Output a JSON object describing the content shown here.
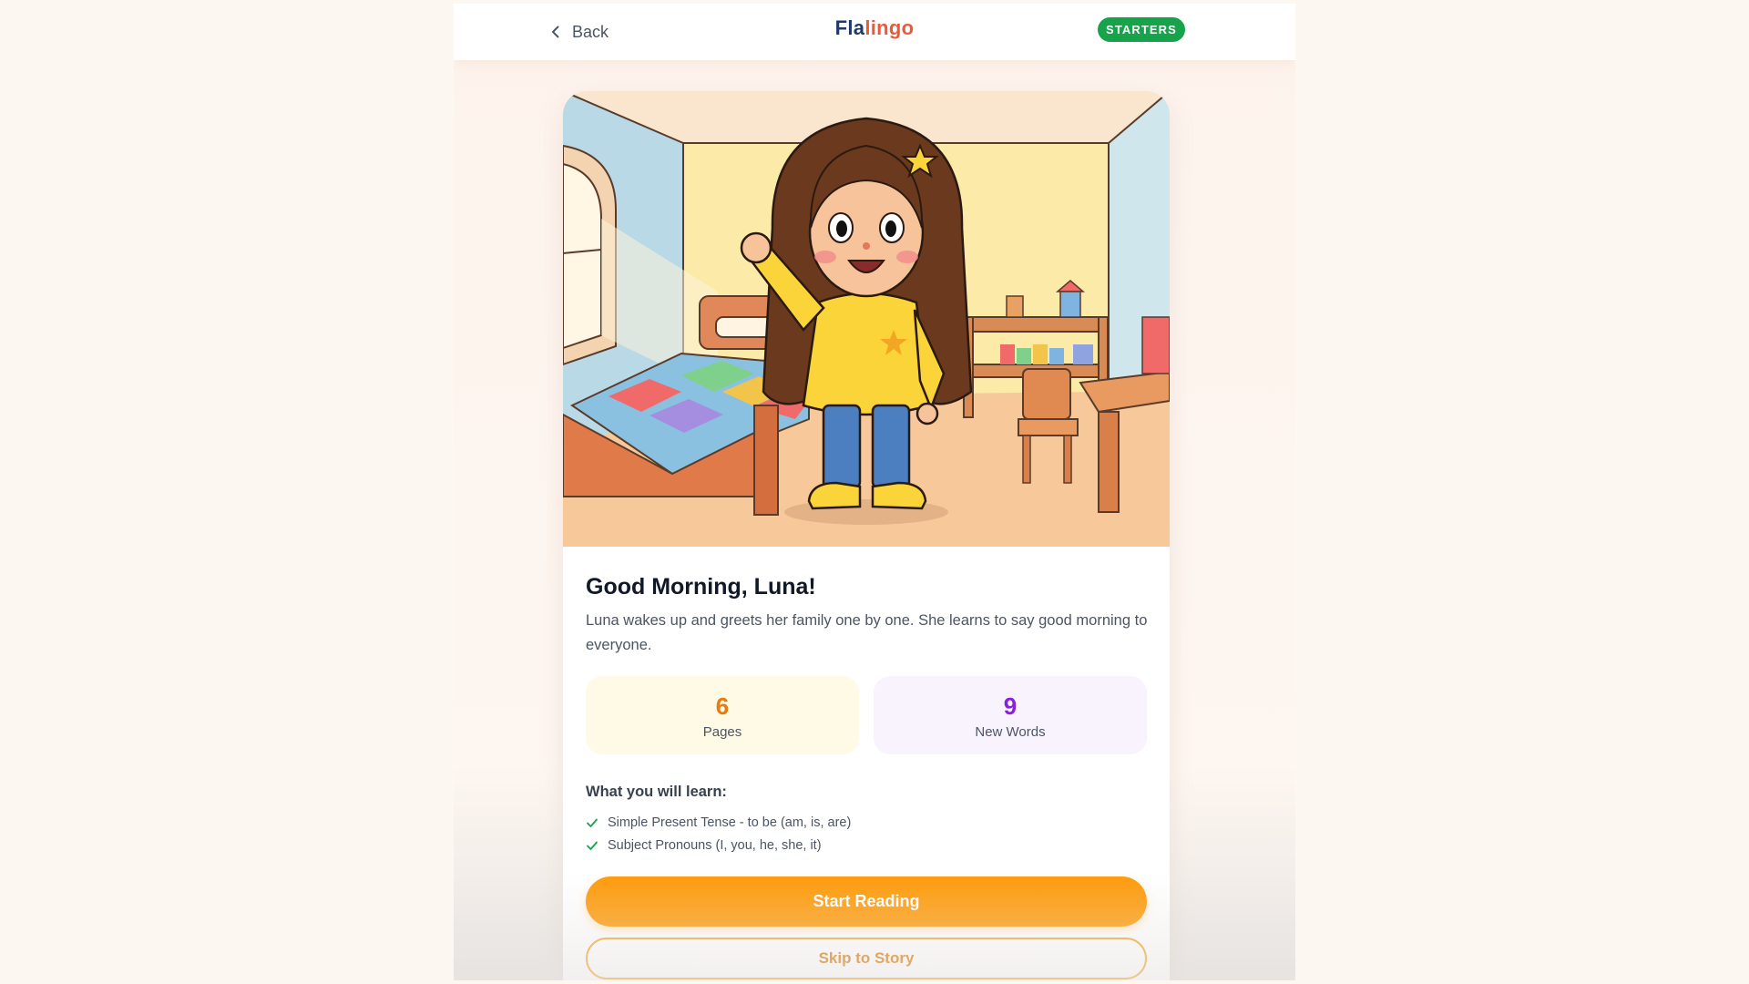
{
  "header": {
    "back_label": "Back",
    "logo_part1": "Fla",
    "logo_part2": "lingo",
    "level_badge": "STARTERS"
  },
  "story": {
    "title": "Good Morning, Luna!",
    "description": "Luna wakes up and greets her family one by one. She learns to say good morning to everyone.",
    "stats": [
      {
        "value": "6",
        "label": "Pages"
      },
      {
        "value": "9",
        "label": "New Words"
      }
    ],
    "learn_heading": "What you will learn:",
    "learn_items": [
      "Simple Present Tense - to be (am, is, are)",
      "Subject Pronouns (I, you, he, she, it)"
    ],
    "start_button": "Start Reading",
    "skip_button": "Skip to Story"
  },
  "colors": {
    "accent_orange": "#fe9a08",
    "badge_green": "#16a34a",
    "pages_number": "#ea7a0c",
    "words_number": "#8b1fe0"
  },
  "icons": {
    "back": "chevron-left-icon",
    "check": "check-icon"
  }
}
